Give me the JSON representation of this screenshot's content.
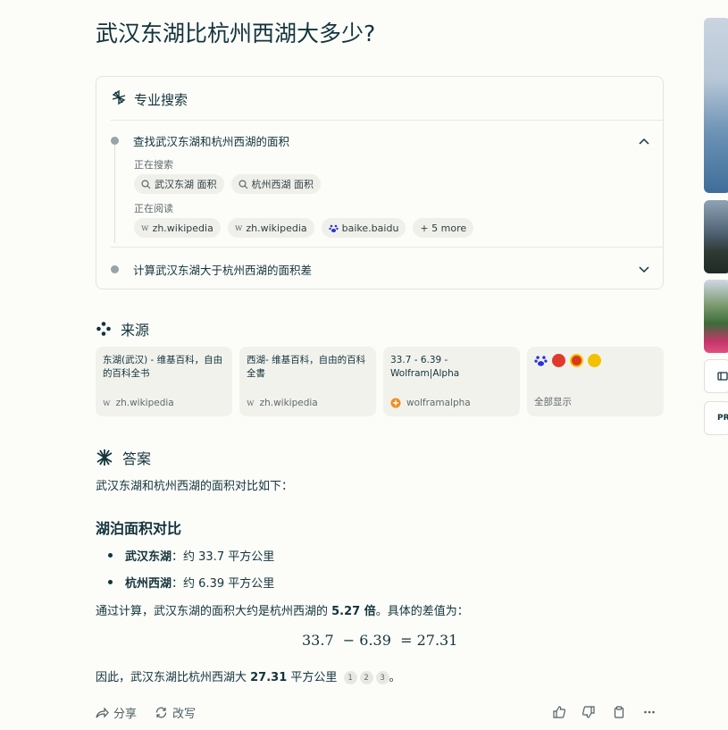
{
  "question": "武汉东湖比杭州西湖大多少?",
  "pro_search": {
    "title": "专业搜索",
    "step1": "查找武汉东湖和杭州西湖的面积",
    "searching_label": "正在搜索",
    "queries": [
      "武汉东湖 面积",
      "杭州西湖 面积"
    ],
    "reading_label": "正在阅读",
    "reads": [
      "zh.wikipedia",
      "zh.wikipedia",
      "baike.baidu"
    ],
    "more": "+ 5 more",
    "step2": "计算武汉东湖大于杭州西湖的面积差"
  },
  "sources": {
    "title": "来源",
    "items": [
      {
        "title": "东湖(武汉) - 维基百科，自由的百科全书",
        "site": "zh.wikipedia"
      },
      {
        "title": "西湖- 维基百科，自由的百科全書",
        "site": "zh.wikipedia"
      },
      {
        "title": "33.7 - 6.39 - Wolfram|Alpha",
        "site": "wolframalpha"
      }
    ],
    "show_all": "全部显示"
  },
  "answer": {
    "title": "答案",
    "intro": "武汉东湖和杭州西湖的面积对比如下：",
    "heading": "湖泊面积对比",
    "bullets": [
      {
        "name": "武汉东湖",
        "value": "约 33.7 平方公里"
      },
      {
        "name": "杭州西湖",
        "value": "约 6.39 平方公里"
      }
    ],
    "calc_prefix": "通过计算，武汉东湖的面积大约是杭州西湖的 ",
    "ratio": "5.27 倍",
    "calc_suffix": "。具体的差值为：",
    "equation": "33.7  − 6.39  = 27.31",
    "conclusion_prefix": "因此，武汉东湖比杭州西湖大 ",
    "diff": "27.31",
    "conclusion_unit": " 平方公里",
    "citations": [
      "1",
      "2",
      "3"
    ],
    "period": "。"
  },
  "footer": {
    "share": "分享",
    "rewrite": "改写"
  },
  "rail": {
    "pro_badge": "PR"
  },
  "colors": {
    "text": "#13343b",
    "muted": "#5f6b6e",
    "card_bg": "#f2f2ed",
    "accent": "#20808d"
  }
}
